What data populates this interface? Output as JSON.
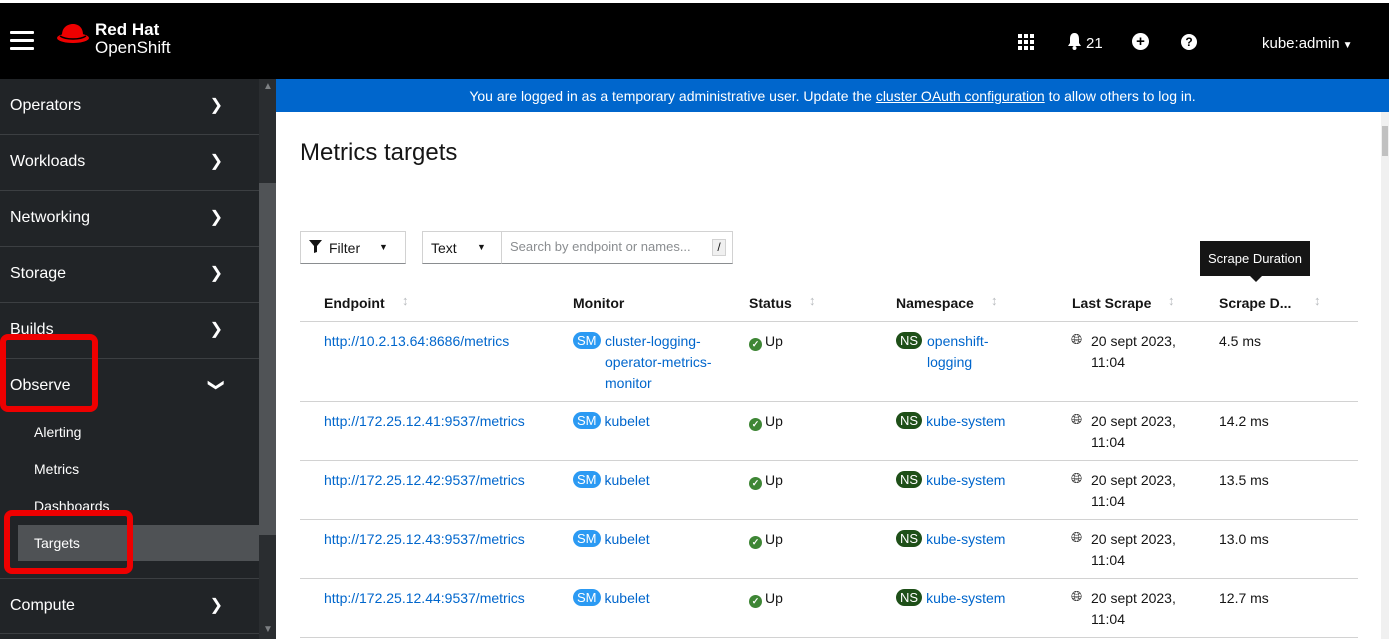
{
  "masthead": {
    "brand_line1": "Red Hat",
    "brand_line2": "OpenShift",
    "notification_count": "21",
    "user": "kube:admin"
  },
  "sidebar": {
    "items": [
      {
        "label": "Operators"
      },
      {
        "label": "Workloads"
      },
      {
        "label": "Networking"
      },
      {
        "label": "Storage"
      },
      {
        "label": "Builds"
      },
      {
        "label": "Observe",
        "expanded": true
      },
      {
        "label": "Compute"
      }
    ],
    "observe_sub": [
      "Alerting",
      "Metrics",
      "Dashboards",
      "Targets"
    ],
    "active_sub": "Targets"
  },
  "banner": {
    "prefix": "You are logged in as a temporary administrative user. Update the ",
    "link": "cluster OAuth configuration",
    "suffix": " to allow others to log in."
  },
  "page": {
    "title": "Metrics targets",
    "filter_label": "Filter",
    "text_label": "Text",
    "search_placeholder": "Search by endpoint or names...",
    "search_shortcut": "/",
    "tooltip": "Scrape Duration"
  },
  "table": {
    "headers": [
      "Endpoint",
      "Monitor",
      "Status",
      "Namespace",
      "Last Scrape",
      "Scrape D..."
    ],
    "rows": [
      {
        "endpoint": "http://10.2.13.64:8686/metrics",
        "monitor_badge": "SM",
        "monitor": "cluster-logging-operator-metrics-monitor",
        "status": "Up",
        "ns_badge": "NS",
        "namespace": "openshift-logging",
        "last_scrape": "20 sept 2023, 11:04",
        "duration": "4.5 ms"
      },
      {
        "endpoint": "http://172.25.12.41:9537/metrics",
        "monitor_badge": "SM",
        "monitor": "kubelet",
        "status": "Up",
        "ns_badge": "NS",
        "namespace": "kube-system",
        "last_scrape": "20 sept 2023, 11:04",
        "duration": "14.2 ms"
      },
      {
        "endpoint": "http://172.25.12.42:9537/metrics",
        "monitor_badge": "SM",
        "monitor": "kubelet",
        "status": "Up",
        "ns_badge": "NS",
        "namespace": "kube-system",
        "last_scrape": "20 sept 2023, 11:04",
        "duration": "13.5 ms"
      },
      {
        "endpoint": "http://172.25.12.43:9537/metrics",
        "monitor_badge": "SM",
        "monitor": "kubelet",
        "status": "Up",
        "ns_badge": "NS",
        "namespace": "kube-system",
        "last_scrape": "20 sept 2023, 11:04",
        "duration": "13.0 ms"
      },
      {
        "endpoint": "http://172.25.12.44:9537/metrics",
        "monitor_badge": "SM",
        "monitor": "kubelet",
        "status": "Up",
        "ns_badge": "NS",
        "namespace": "kube-system",
        "last_scrape": "20 sept 2023, 11:04",
        "duration": "12.7 ms"
      }
    ]
  },
  "colors": {
    "masthead_bg": "#000000",
    "sidebar_bg": "#212427",
    "banner_bg": "#0066cc",
    "link": "#0066cc",
    "highlight": "#ee0000",
    "status_up": "#3e8635"
  }
}
